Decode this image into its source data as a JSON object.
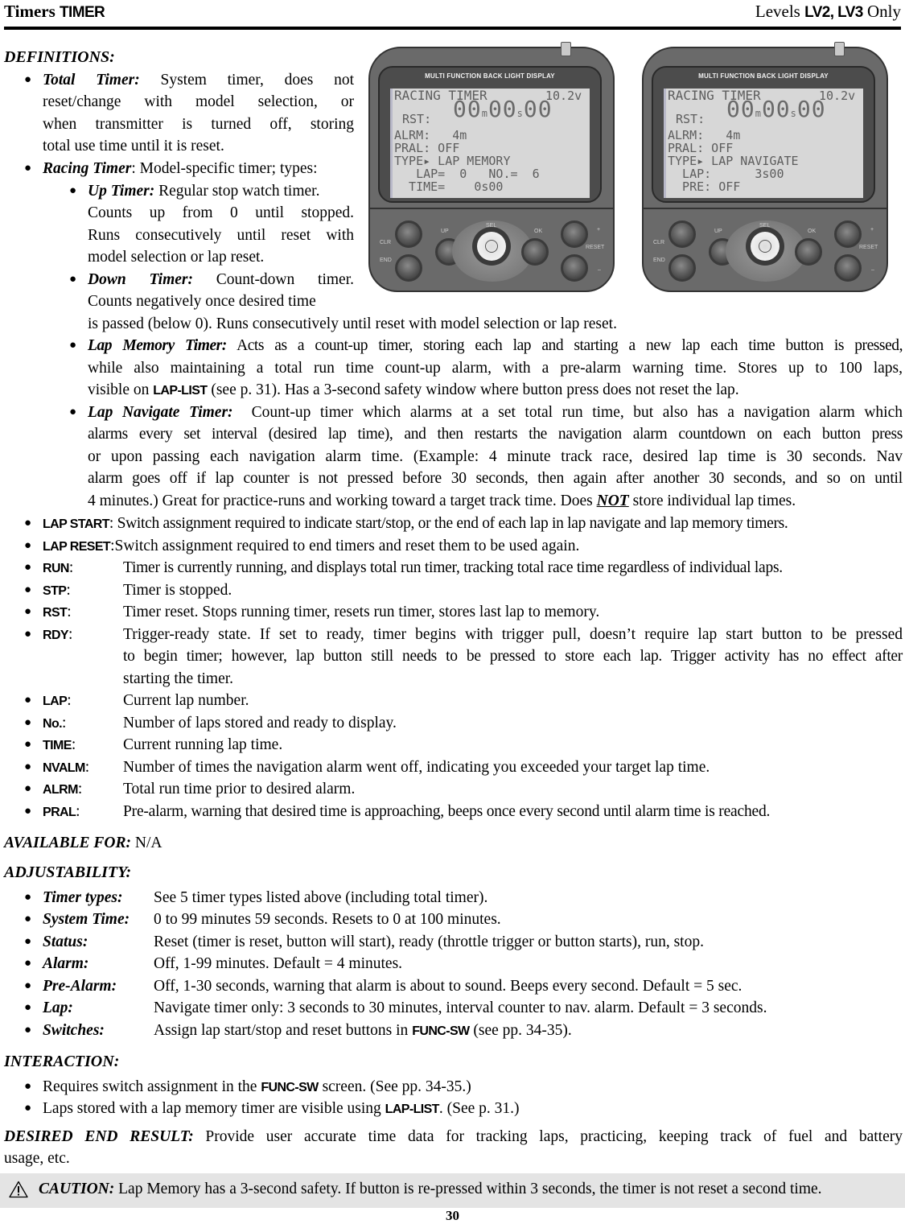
{
  "header": {
    "left_title": "Timers",
    "left_code": "TIMER",
    "right_prefix": "Levels",
    "right_levels": "LV2, LV3",
    "right_suffix": "Only"
  },
  "definitions": {
    "title": "DEFINITIONS:",
    "total_timer": {
      "term": "Total Timer:",
      "lines": [
        "System timer, does not",
        "reset/change with model selection, or",
        "when transmitter is turned off, storing",
        "total use time until it is reset."
      ]
    },
    "racing_timer": {
      "term": "Racing Timer",
      "text": ": Model-specific timer; types:"
    },
    "up_timer": {
      "term": "Up Timer:",
      "lines": [
        "Regular stop watch timer.",
        "Counts up from 0 until stopped.",
        "Runs consecutively until reset with",
        "model selection or lap reset."
      ]
    },
    "down_timer": {
      "term": "Down Timer:",
      "lines": [
        "Count-down timer.",
        "Counts negatively once desired time",
        "is passed (below 0). Runs consecutively until reset with model selection or lap reset."
      ]
    },
    "lap_memory_timer": {
      "term": "Lap Memory Timer:",
      "line1": "Acts as a count-up timer, storing each lap and starting a new lap each time button is pressed,",
      "line2": "while also maintaining a total run time count-up alarm, with a pre-alarm warning time. Stores up to 100 laps,",
      "line3_pre": "visible on",
      "line3_code": "LAP-LIST",
      "line3_post": "(see p. 31). Has a 3-second safety window where button press does not reset the lap."
    },
    "lap_navigate_timer": {
      "term": "Lap Navigate Timer:",
      "line1": "Count-up timer which alarms at a set total run time, but also has a navigation alarm which",
      "line2": "alarms every set interval (desired lap time), and then restarts the navigation alarm countdown on each button press",
      "line3": "or upon passing each navigation alarm time. (Example: 4 minute track race, desired lap time is 30 seconds. Nav",
      "line4": "alarm goes off if lap counter is not pressed before 30 seconds, then again after another 30 seconds, and so on until",
      "line5_pre": "4 minutes.) Great for practice-runs and working toward a target track time. Does",
      "line5_emph": "NOT",
      "line5_post": "store individual lap times."
    },
    "terms": [
      {
        "code": "LAP START",
        "text": ": Switch assignment required to indicate start/stop, or the end of each lap in lap navigate and lap memory timers."
      },
      {
        "code": "LAP RESET",
        "text": ":Switch assignment required to end timers and reset them to be used again."
      },
      {
        "code": "RUN",
        "text": "Timer is currently running, and displays total run timer, tracking total race time regardless of individual laps."
      },
      {
        "code": "STP",
        "text": "Timer is stopped."
      },
      {
        "code": "RST",
        "text": "Timer reset. Stops running timer, resets run timer, stores last lap to memory."
      },
      {
        "code": "RDY",
        "text": "Trigger-ready state. If set to ready, timer begins with trigger pull, doesn’t require lap start button to be pressed",
        "text2": "to begin timer; however, lap button still needs to be pressed to store each lap. Trigger activity has no effect after",
        "text3": "starting the timer."
      },
      {
        "code": "LAP",
        "text": "Current lap number."
      },
      {
        "code": "No.",
        "text": "Number of laps stored and ready to display."
      },
      {
        "code": "TIME",
        "text": "Current running lap time."
      },
      {
        "code": "NVALM",
        "text": "Number of times the navigation alarm went off, indicating you exceeded your target lap time."
      },
      {
        "code": "ALRM",
        "text": "Total run time prior to desired alarm."
      },
      {
        "code": "PRAL",
        "text": "Pre-alarm, warning that desired time is approaching, beeps once every second until alarm time is reached."
      }
    ]
  },
  "available_for": {
    "label": "AVAILABLE FOR:",
    "value": "N/A"
  },
  "adjustability": {
    "title": "ADJUSTABILITY:",
    "items": [
      {
        "term": "Timer types:",
        "text": "See 5 timer types listed above (including total timer)."
      },
      {
        "term": "System Time:",
        "text": "0 to 99 minutes 59 seconds. Resets to 0 at 100 minutes."
      },
      {
        "term": "Status:",
        "text": "Reset (timer is reset, button will start), ready (throttle trigger or button starts), run, stop."
      },
      {
        "term": "Alarm:",
        "text": "Off, 1-99 minutes. Default = 4 minutes."
      },
      {
        "term": "Pre-Alarm:",
        "text": "Off, 1-30 seconds, warning that alarm is about to sound. Beeps every second. Default = 5 sec."
      },
      {
        "term": "Lap:",
        "text": "Navigate timer only: 3 seconds to 30 minutes, interval counter to nav. alarm. Default = 3 seconds."
      },
      {
        "term": "Switches:",
        "text_pre": "Assign lap start/stop and reset buttons in",
        "code": "FUNC-SW",
        "text_post": "(see pp. 34-35)."
      }
    ]
  },
  "interaction": {
    "title": "INTERACTION:",
    "items": [
      {
        "pre": "Requires switch assignment in the",
        "code": "FUNC-SW",
        "post": "screen. (See pp. 34-35.)"
      },
      {
        "pre": "Laps stored with a lap memory timer are visible using",
        "code": "LAP-LIST",
        "post": ". (See p. 31.)"
      }
    ]
  },
  "desired_end_result": {
    "label": "DESIRED END RESULT:",
    "line1": "Provide user accurate time data for tracking laps, practicing, keeping track of fuel and battery",
    "line2": "usage, etc."
  },
  "caution": {
    "icon": "warning-triangle-icon",
    "label": "CAUTION:",
    "text": "Lap Memory has a 3-second safety. If button is re-pressed within 3 seconds, the timer is not reset a second time."
  },
  "page_number": "30",
  "devices": [
    {
      "bezel_label": "MULTI  FUNCTION  BACK  LIGHT  DISPLAY",
      "screen_title": "RACING TIMER",
      "voltage": "10.2v",
      "status": "RST:",
      "time_min": "00",
      "time_sec": "00",
      "time_hund": "00",
      "rows": [
        "ALRM:   4m",
        "PRAL: OFF",
        "TYPE▸ LAP MEMORY",
        "   LAP=  0   NO.=  6",
        "  TIME=    0s00"
      ],
      "buttons": {
        "clr": "CLR",
        "end": "END",
        "up": "UP",
        "sel": "SEL",
        "ok": "OK",
        "plus": "+",
        "reset": "RESET",
        "minus": "–"
      }
    },
    {
      "bezel_label": "MULTI  FUNCTION  BACK  LIGHT  DISPLAY",
      "screen_title": "RACING TIMER",
      "voltage": "10.2v",
      "status": "RST:",
      "time_min": "00",
      "time_sec": "00",
      "time_hund": "00",
      "rows": [
        "ALRM:   4m",
        "PRAL: OFF",
        "TYPE▸ LAP NAVIGATE",
        "  LAP:      3s00",
        "  PRE: OFF"
      ],
      "buttons": {
        "clr": "CLR",
        "end": "END",
        "up": "UP",
        "sel": "SEL",
        "ok": "OK",
        "plus": "+",
        "reset": "RESET",
        "minus": "–"
      }
    }
  ]
}
